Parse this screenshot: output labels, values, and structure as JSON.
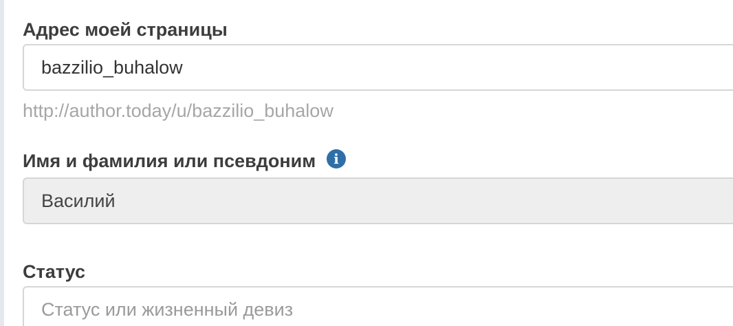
{
  "page_address": {
    "label": "Адрес моей страницы",
    "value": "bazzilio_buhalow",
    "hint": "http://author.today/u/bazzilio_buhalow"
  },
  "name": {
    "label": "Имя и фамилия или псевдоним",
    "info_icon": "info-icon",
    "value": "Василий"
  },
  "status": {
    "label": "Статус",
    "value": "",
    "placeholder": "Статус или жизненный девиз"
  },
  "colors": {
    "label_text": "#3d3d3d",
    "hint_text": "#a6a6a6",
    "border": "#d6d6d6",
    "disabled_bg": "#eeeeee",
    "info_icon_bg": "#2f6fa7"
  }
}
